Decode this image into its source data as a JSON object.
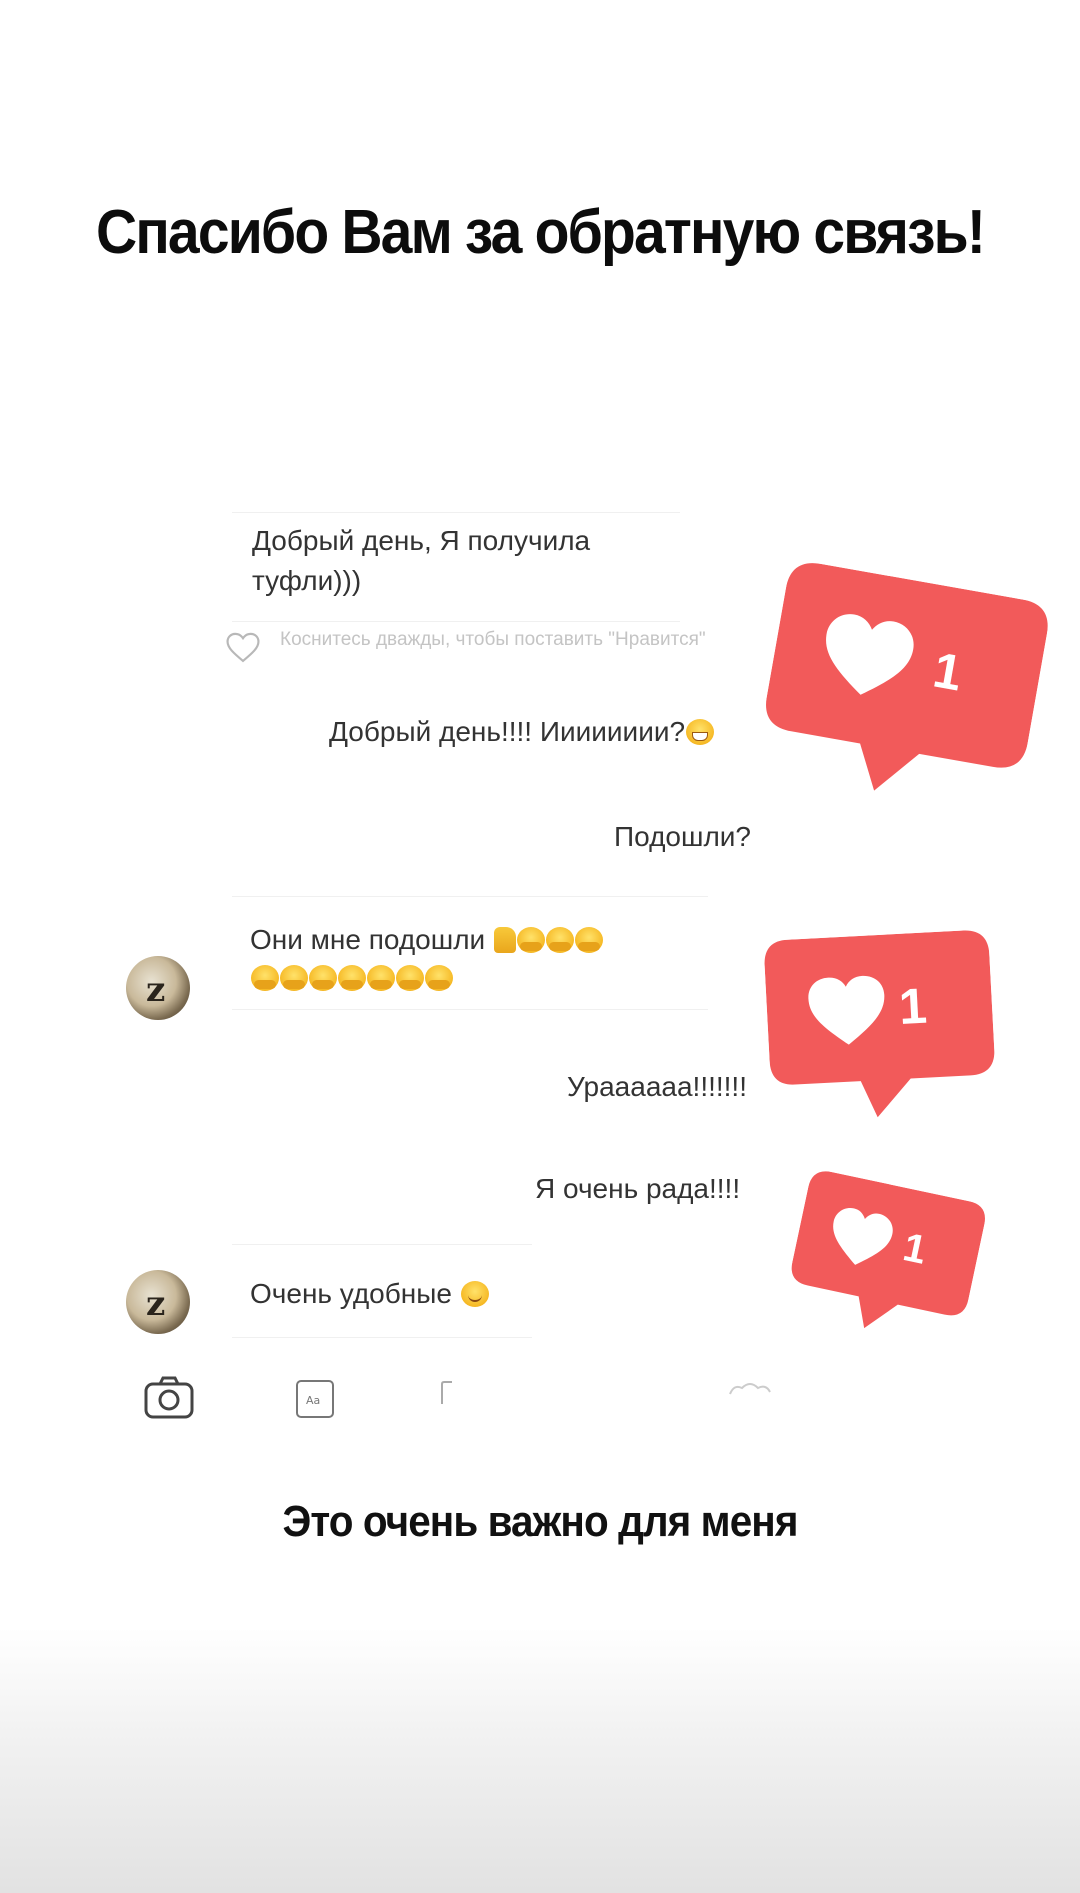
{
  "headline": "Спасибо Вам за обратную связь!",
  "footer": "Это очень важно для меня",
  "chat": {
    "messages": [
      {
        "side": "in",
        "text": "Добрый день, Я получила туфли)))"
      },
      {
        "side": "out",
        "text": "Добрый день!!!! Ииииииии?",
        "emoji": "grinning-face"
      },
      {
        "side": "out",
        "text": "Подошли?"
      },
      {
        "side": "in",
        "text": "Они мне подошли",
        "emoji": "thumbs-up, hugging-face x10"
      },
      {
        "side": "out",
        "text": "Урааааaa!!!!!!!"
      },
      {
        "side": "out",
        "text": "Я очень рада!!!!"
      },
      {
        "side": "in",
        "text": "Очень удобные",
        "emoji": "smiling-face"
      }
    ],
    "like_hint": "Коснитесь дважды, чтобы поставить \"Нравится\""
  },
  "badges": [
    {
      "count": "1",
      "icon": "heart-icon"
    },
    {
      "count": "1",
      "icon": "heart-icon"
    },
    {
      "count": "1",
      "icon": "heart-icon"
    }
  ],
  "toolbar": [
    "camera-icon",
    "sticker-icon",
    "gallery-icon",
    "heart-icon"
  ],
  "colors": {
    "badge": "#f25a5a",
    "text": "#333333",
    "headline": "#0c0c0c"
  }
}
